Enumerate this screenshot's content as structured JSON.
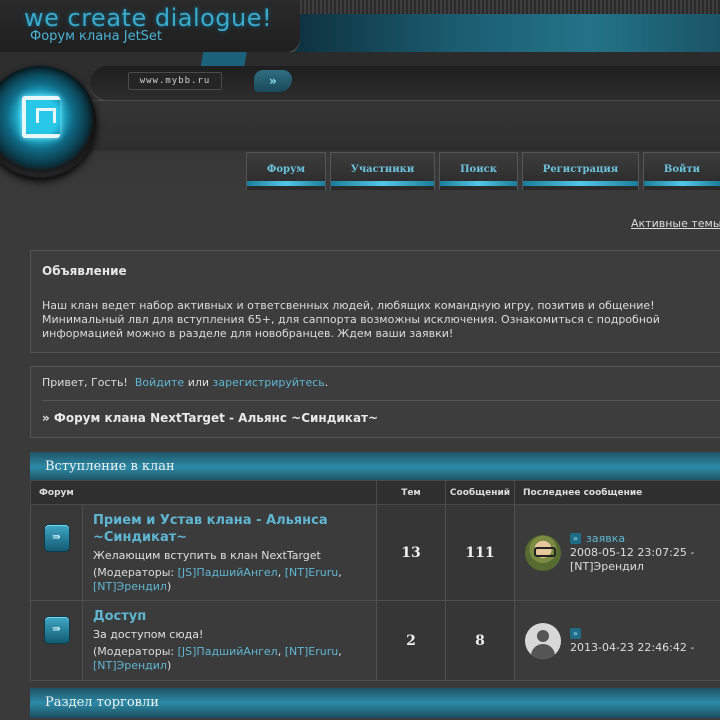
{
  "header": {
    "slogan": "we create dialogue!",
    "board_title": "Форум клана JetSet",
    "url": "www.mybb.ru",
    "go": "»"
  },
  "nav": [
    {
      "label": "Форум"
    },
    {
      "label": "Участники"
    },
    {
      "label": "Поиск"
    },
    {
      "label": "Регистрация"
    },
    {
      "label": "Войти"
    }
  ],
  "active_topics": "Активные темы",
  "announcement": {
    "title": "Объявление",
    "text": "Наш клан ведет набор активных и ответсвенных людей, любящих командную игру, позитив и общение! Минимальный лвл для вступления 65+, для саппорта возможны исключения. Ознакомиться с подробной информацией можно в разделе для новобранцев. Ждем ваши заявки!"
  },
  "welcome": {
    "greeting": "Привет, Гость!",
    "login": "Войдите",
    "or": "или",
    "register": "зарегистрируйтесь",
    "period": ".",
    "crumb": "» Форум клана NextTarget - Альянс ~Синдикат~"
  },
  "categories": [
    {
      "title": "Вступление в клан"
    },
    {
      "title": "Раздел торговли"
    }
  ],
  "table_headers": {
    "forum": "Форум",
    "topics": "Тем",
    "posts": "Сообщений",
    "last": "Последнее сообщение"
  },
  "forums": [
    {
      "name": "Прием и Устав клана - Альянса ~Синдикат~",
      "desc": "Желающим вступить в клан NextTarget",
      "mods_prefix": "(Модераторы: ",
      "mods": [
        "[JS]ПадшийАнгел",
        "[NT]Eruru",
        "[NT]Эрендил"
      ],
      "comma": ", ",
      "mods_suffix": ")",
      "topics": "13",
      "posts": "111",
      "last_topic": "заявка",
      "last_date": "2008-05-12 23:07:25 -",
      "last_author": "[NT]Эрендил"
    },
    {
      "name": "Доступ",
      "desc": "За доступом сюда!",
      "mods_prefix": "(Модераторы: ",
      "mods": [
        "[JS]ПадшийАнгел",
        "[NT]Eruru",
        "[NT]Эрендил"
      ],
      "comma": ", ",
      "mods_suffix": ")",
      "topics": "2",
      "posts": "8",
      "last_topic": "",
      "last_date": "2013-04-23 22:46:42 -",
      "last_author": ""
    }
  ],
  "icons": {
    "forum_icon": "forum-icon",
    "jump_icon": "jump-to-post-icon",
    "logo_icon": "logo-orb-icon"
  },
  "colors": {
    "accent": "#5fb6d2",
    "teal": "#2c8aa6",
    "background": "#3a3a3a"
  }
}
